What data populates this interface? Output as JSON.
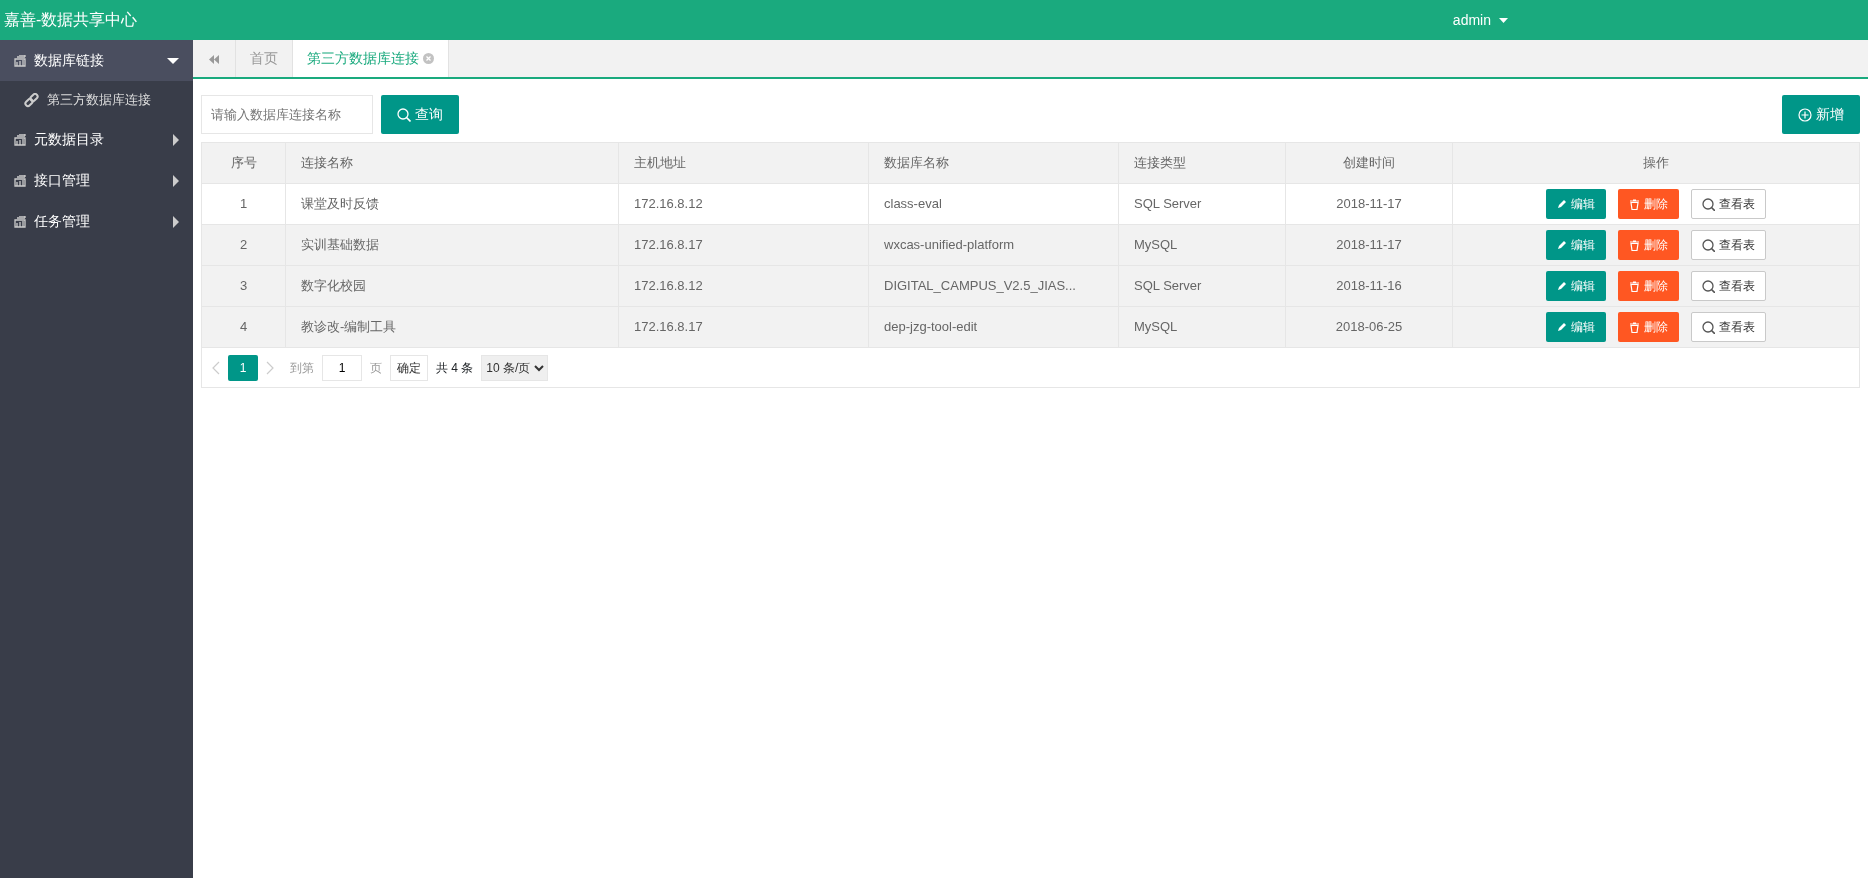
{
  "header": {
    "title": "嘉善-数据共享中心",
    "user": "admin"
  },
  "sidebar": {
    "items": [
      {
        "label": "数据库链接",
        "expanded": true,
        "selected": true,
        "children": [
          {
            "label": "第三方数据库连接",
            "selected": false
          }
        ]
      },
      {
        "label": "元数据目录",
        "expanded": false,
        "selected": false
      },
      {
        "label": "接口管理",
        "expanded": false,
        "selected": false
      },
      {
        "label": "任务管理",
        "expanded": false,
        "selected": false
      }
    ]
  },
  "tabs": [
    {
      "label": "首页",
      "selected": false,
      "closable": false
    },
    {
      "label": "第三方数据库连接",
      "selected": true,
      "closable": true
    }
  ],
  "search": {
    "placeholder": "请输入数据库连接名称",
    "button": "查询"
  },
  "add_button": "新增",
  "table": {
    "columns": [
      "序号",
      "连接名称",
      "主机地址",
      "数据库名称",
      "连接类型",
      "创建时间",
      "操作"
    ],
    "rows": [
      {
        "cells": [
          "1",
          "课堂及时反馈",
          "172.16.8.12",
          "class-eval",
          "SQL Server",
          "2018-11-17"
        ],
        "actions": [
          "编辑",
          "删除",
          "查看表"
        ],
        "highlighted": false
      },
      {
        "cells": [
          "2",
          "实训基础数据",
          "172.16.8.17",
          "wxcas-unified-platform",
          "MySQL",
          "2018-11-17"
        ],
        "actions": [
          "编辑",
          "删除",
          "查看表"
        ],
        "highlighted": true
      },
      {
        "cells": [
          "3",
          "数字化校园",
          "172.16.8.12",
          "DIGITAL_CAMPUS_V2.5_JIAS...",
          "SQL Server",
          "2018-11-16"
        ],
        "actions": [
          "编辑",
          "删除",
          "查看表"
        ],
        "highlighted": true
      },
      {
        "cells": [
          "4",
          "教诊改-编制工具",
          "172.16.8.17",
          "dep-jzg-tool-edit",
          "MySQL",
          "2018-06-25"
        ],
        "actions": [
          "编辑",
          "删除",
          "查看表"
        ],
        "highlighted": true
      }
    ]
  },
  "pagination": {
    "pages": [
      {
        "label": "1",
        "selected": true
      }
    ],
    "goto_label": "到第",
    "goto_value": "1",
    "page_unit": "页",
    "confirm": "确定",
    "total": "共 4 条",
    "page_size": "10 条/页"
  }
}
